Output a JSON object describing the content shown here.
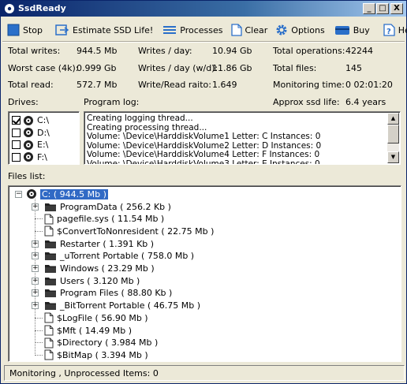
{
  "window": {
    "title": "SsdReady",
    "btn_min": "_",
    "btn_max": "□",
    "btn_close": "X"
  },
  "toolbar": {
    "stop": "Stop",
    "estimate": "Estimate SSD Life!",
    "processes": "Processes",
    "clear": "Clear",
    "options": "Options",
    "buy": "Buy",
    "help": "Help"
  },
  "stats": {
    "total_writes_label": "Total writes:",
    "total_writes": "944.5 Mb",
    "writes_day_label": "Writes / day:",
    "writes_day": "10.94 Gb",
    "total_ops_label": "Total operations:",
    "total_ops": "42244",
    "worst_case_label": "Worst case (4k):",
    "worst_case": "0.999 Gb",
    "writes_day_wd_label": "Writes / day (w/d):",
    "writes_day_wd": "11.86 Gb",
    "total_files_label": "Total files:",
    "total_files": "145",
    "total_read_label": "Total read:",
    "total_read": "572.7 Mb",
    "write_read_label": "Write/Read raito:",
    "write_read": "1.649",
    "monitoring_time_label": "Monitoring time:",
    "monitoring_time": "0 02:01:20",
    "ssd_life_label": "Approx ssd life:",
    "ssd_life": "6.4 years"
  },
  "drives": {
    "label": "Drives:",
    "items": [
      {
        "name": "C:\\",
        "checked": true
      },
      {
        "name": "D:\\",
        "checked": false
      },
      {
        "name": "E:\\",
        "checked": false
      },
      {
        "name": "F:\\",
        "checked": false
      }
    ]
  },
  "log": {
    "label": "Program log:",
    "lines": [
      "Creating logging thread...",
      "Creating processing thread...",
      "Volume: \\Device\\HarddiskVolume1  Letter: C  Instances: 0",
      "Volume: \\Device\\HarddiskVolume2  Letter: D  Instances: 0",
      "Volume: \\Device\\HarddiskVolume4  Letter: F  Instances: 0",
      "Volume: \\Device\\HarddiskVolume3  Letter: E  Instances: 0"
    ]
  },
  "files": {
    "label": "Files list:",
    "root": "C: ( 944.5 Mb )",
    "items": [
      {
        "name": "ProgramData ( 256.2 Kb )",
        "type": "folder"
      },
      {
        "name": "pagefile.sys ( 11.54 Mb )",
        "type": "file"
      },
      {
        "name": "$ConvertToNonresident ( 22.75 Mb )",
        "type": "file"
      },
      {
        "name": "Restarter ( 1.391 Kb )",
        "type": "folder"
      },
      {
        "name": "_uTorrent Portable ( 758.0 Mb )",
        "type": "folder"
      },
      {
        "name": "Windows ( 23.29 Mb )",
        "type": "folder"
      },
      {
        "name": "Users ( 3.120 Mb )",
        "type": "folder"
      },
      {
        "name": "Program Files ( 88.80 Kb )",
        "type": "folder"
      },
      {
        "name": "_BitTorrent Portable ( 46.75 Mb )",
        "type": "folder"
      },
      {
        "name": "$LogFile ( 56.90 Mb )",
        "type": "file"
      },
      {
        "name": "$Mft ( 14.49 Mb )",
        "type": "file"
      },
      {
        "name": "$Directory ( 3.984 Mb )",
        "type": "file"
      },
      {
        "name": "$BitMap ( 3.394 Mb )",
        "type": "file"
      }
    ]
  },
  "status": {
    "text": "Monitoring  , Unprocessed Items: 0"
  },
  "icons": {
    "stop": "stop-icon",
    "estimate": "estimate-icon",
    "processes": "list-icon",
    "clear": "document-icon",
    "options": "gear-icon",
    "buy": "card-icon",
    "help": "help-icon"
  },
  "colors": {
    "accent": "#0a246a",
    "selection": "#316ac5",
    "folder": "#222222"
  }
}
